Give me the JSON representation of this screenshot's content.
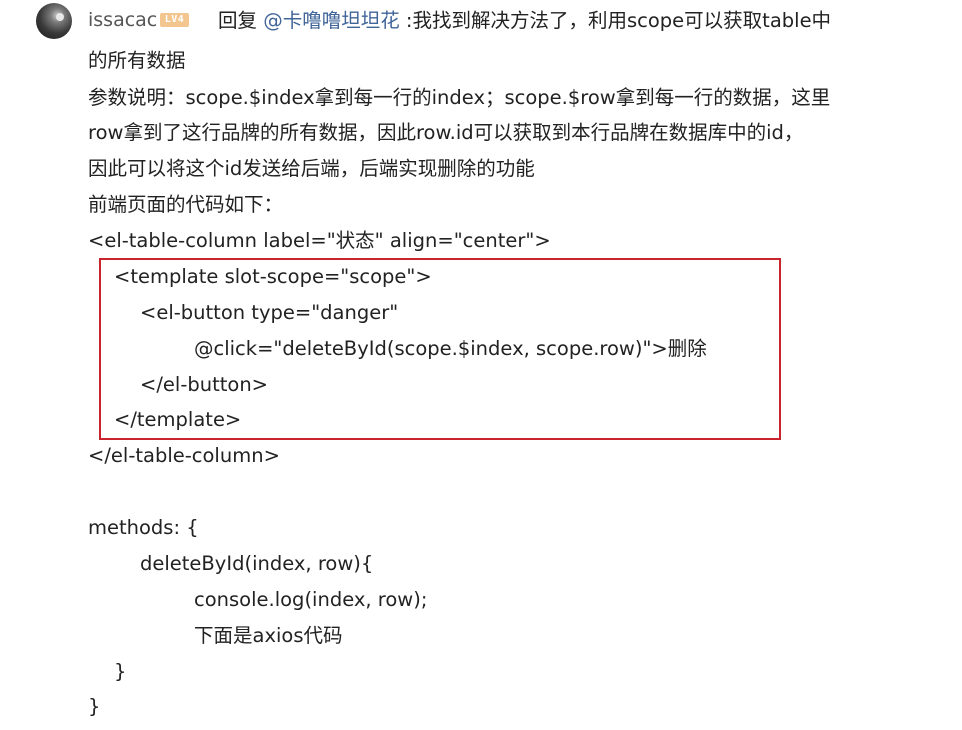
{
  "comment": {
    "username": "issacac",
    "level_badge": "LV4",
    "reply_prefix": "回复 ",
    "mention": "@卡噜噜坦坦花",
    "first_line_rest": " :我找到解决方法了，利用scope可以获取table中",
    "lines": [
      "的所有数据",
      "参数说明：scope.$index拿到每一行的index；scope.$row拿到每一行的数据，这里",
      "row拿到了这行品牌的所有数据，因此row.id可以获取到本行品牌在数据库中的id，",
      "因此可以将这个id发送给后端，后端实现删除的功能",
      "前端页面的代码如下：",
      "<el-table-column label=\"状态\" align=\"center\">",
      "<template slot-scope=\"scope\">",
      "<el-button type=\"danger\"",
      "@click=\"deleteById(scope.$index, scope.row)\">删除",
      "</el-button>",
      "</template>",
      "</el-table-column>",
      "methods: {",
      "deleteById(index, row){",
      "console.log(index, row);",
      "下面是axios代码",
      "}",
      "}"
    ]
  },
  "colors": {
    "mention": "#406599",
    "highlight_border": "#c8242c",
    "badge_bg": "#f3c690"
  },
  "icons": {
    "avatar": "user-avatar",
    "badge": "level-badge"
  }
}
